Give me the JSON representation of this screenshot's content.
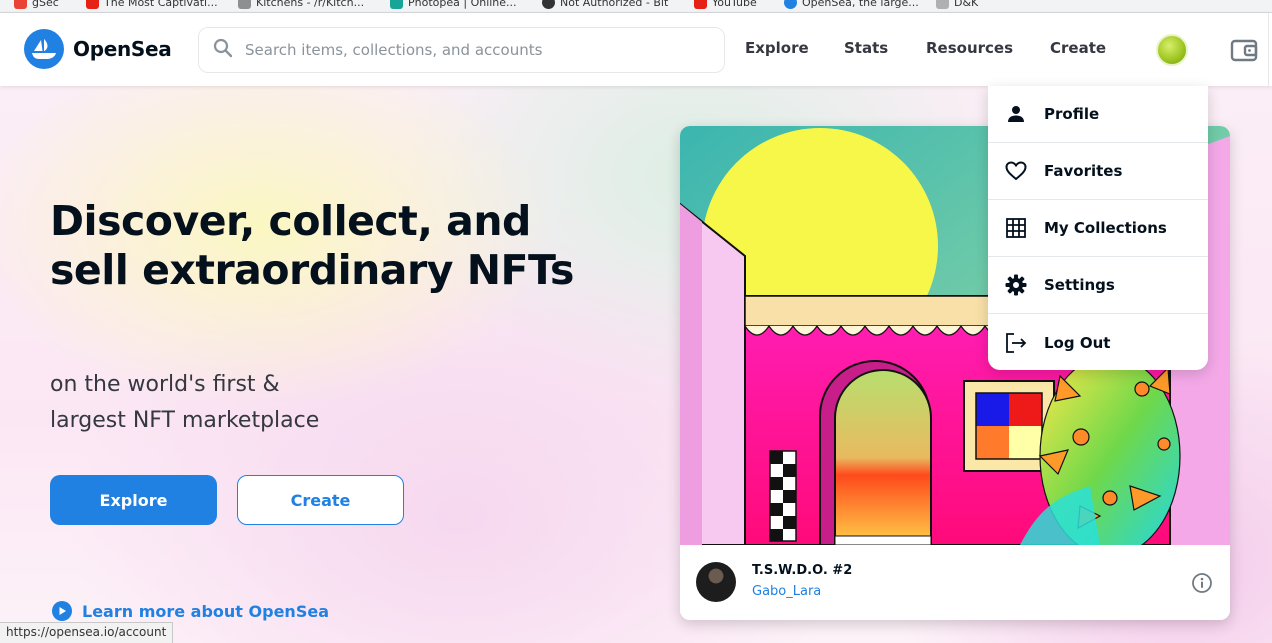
{
  "browser": {
    "bookmarks": [
      {
        "label": "gSec",
        "color": "#ea4335"
      },
      {
        "label": "The Most Captivati...",
        "color": "#e62117"
      },
      {
        "label": "Kitchens - /r/Kitch...",
        "color": "#8f8f8f"
      },
      {
        "label": "Photopea | Online...",
        "color": "#18a497"
      },
      {
        "label": "Not Authorized - Bit",
        "color": "#333333"
      },
      {
        "label": "YouTube",
        "color": "#e62117"
      },
      {
        "label": "OpenSea, the large...",
        "color": "#2081e2"
      },
      {
        "label": "D&K",
        "color": "#b0b0b0"
      }
    ],
    "status_url": "https://opensea.io/account"
  },
  "header": {
    "brand": "OpenSea",
    "search_placeholder": "Search items, collections, and accounts",
    "nav": [
      "Explore",
      "Stats",
      "Resources",
      "Create"
    ]
  },
  "dropdown": {
    "items": [
      {
        "label": "Profile",
        "icon": "person-icon"
      },
      {
        "label": "Favorites",
        "icon": "heart-icon"
      },
      {
        "label": "My Collections",
        "icon": "grid-icon"
      },
      {
        "label": "Settings",
        "icon": "gear-icon"
      },
      {
        "label": "Log Out",
        "icon": "logout-icon"
      }
    ]
  },
  "hero": {
    "headline": "Discover, collect, and sell extraordinary NFTs",
    "subline_1": "on the world's first &",
    "subline_2": "largest NFT marketplace",
    "primary_button": "Explore",
    "secondary_button": "Create",
    "learn_more": "Learn more about OpenSea"
  },
  "featured": {
    "title": "T.S.W.D.O. #2",
    "creator": "Gabo_Lara"
  },
  "colors": {
    "brand_blue": "#2081e2",
    "text_dark": "#04111d"
  }
}
